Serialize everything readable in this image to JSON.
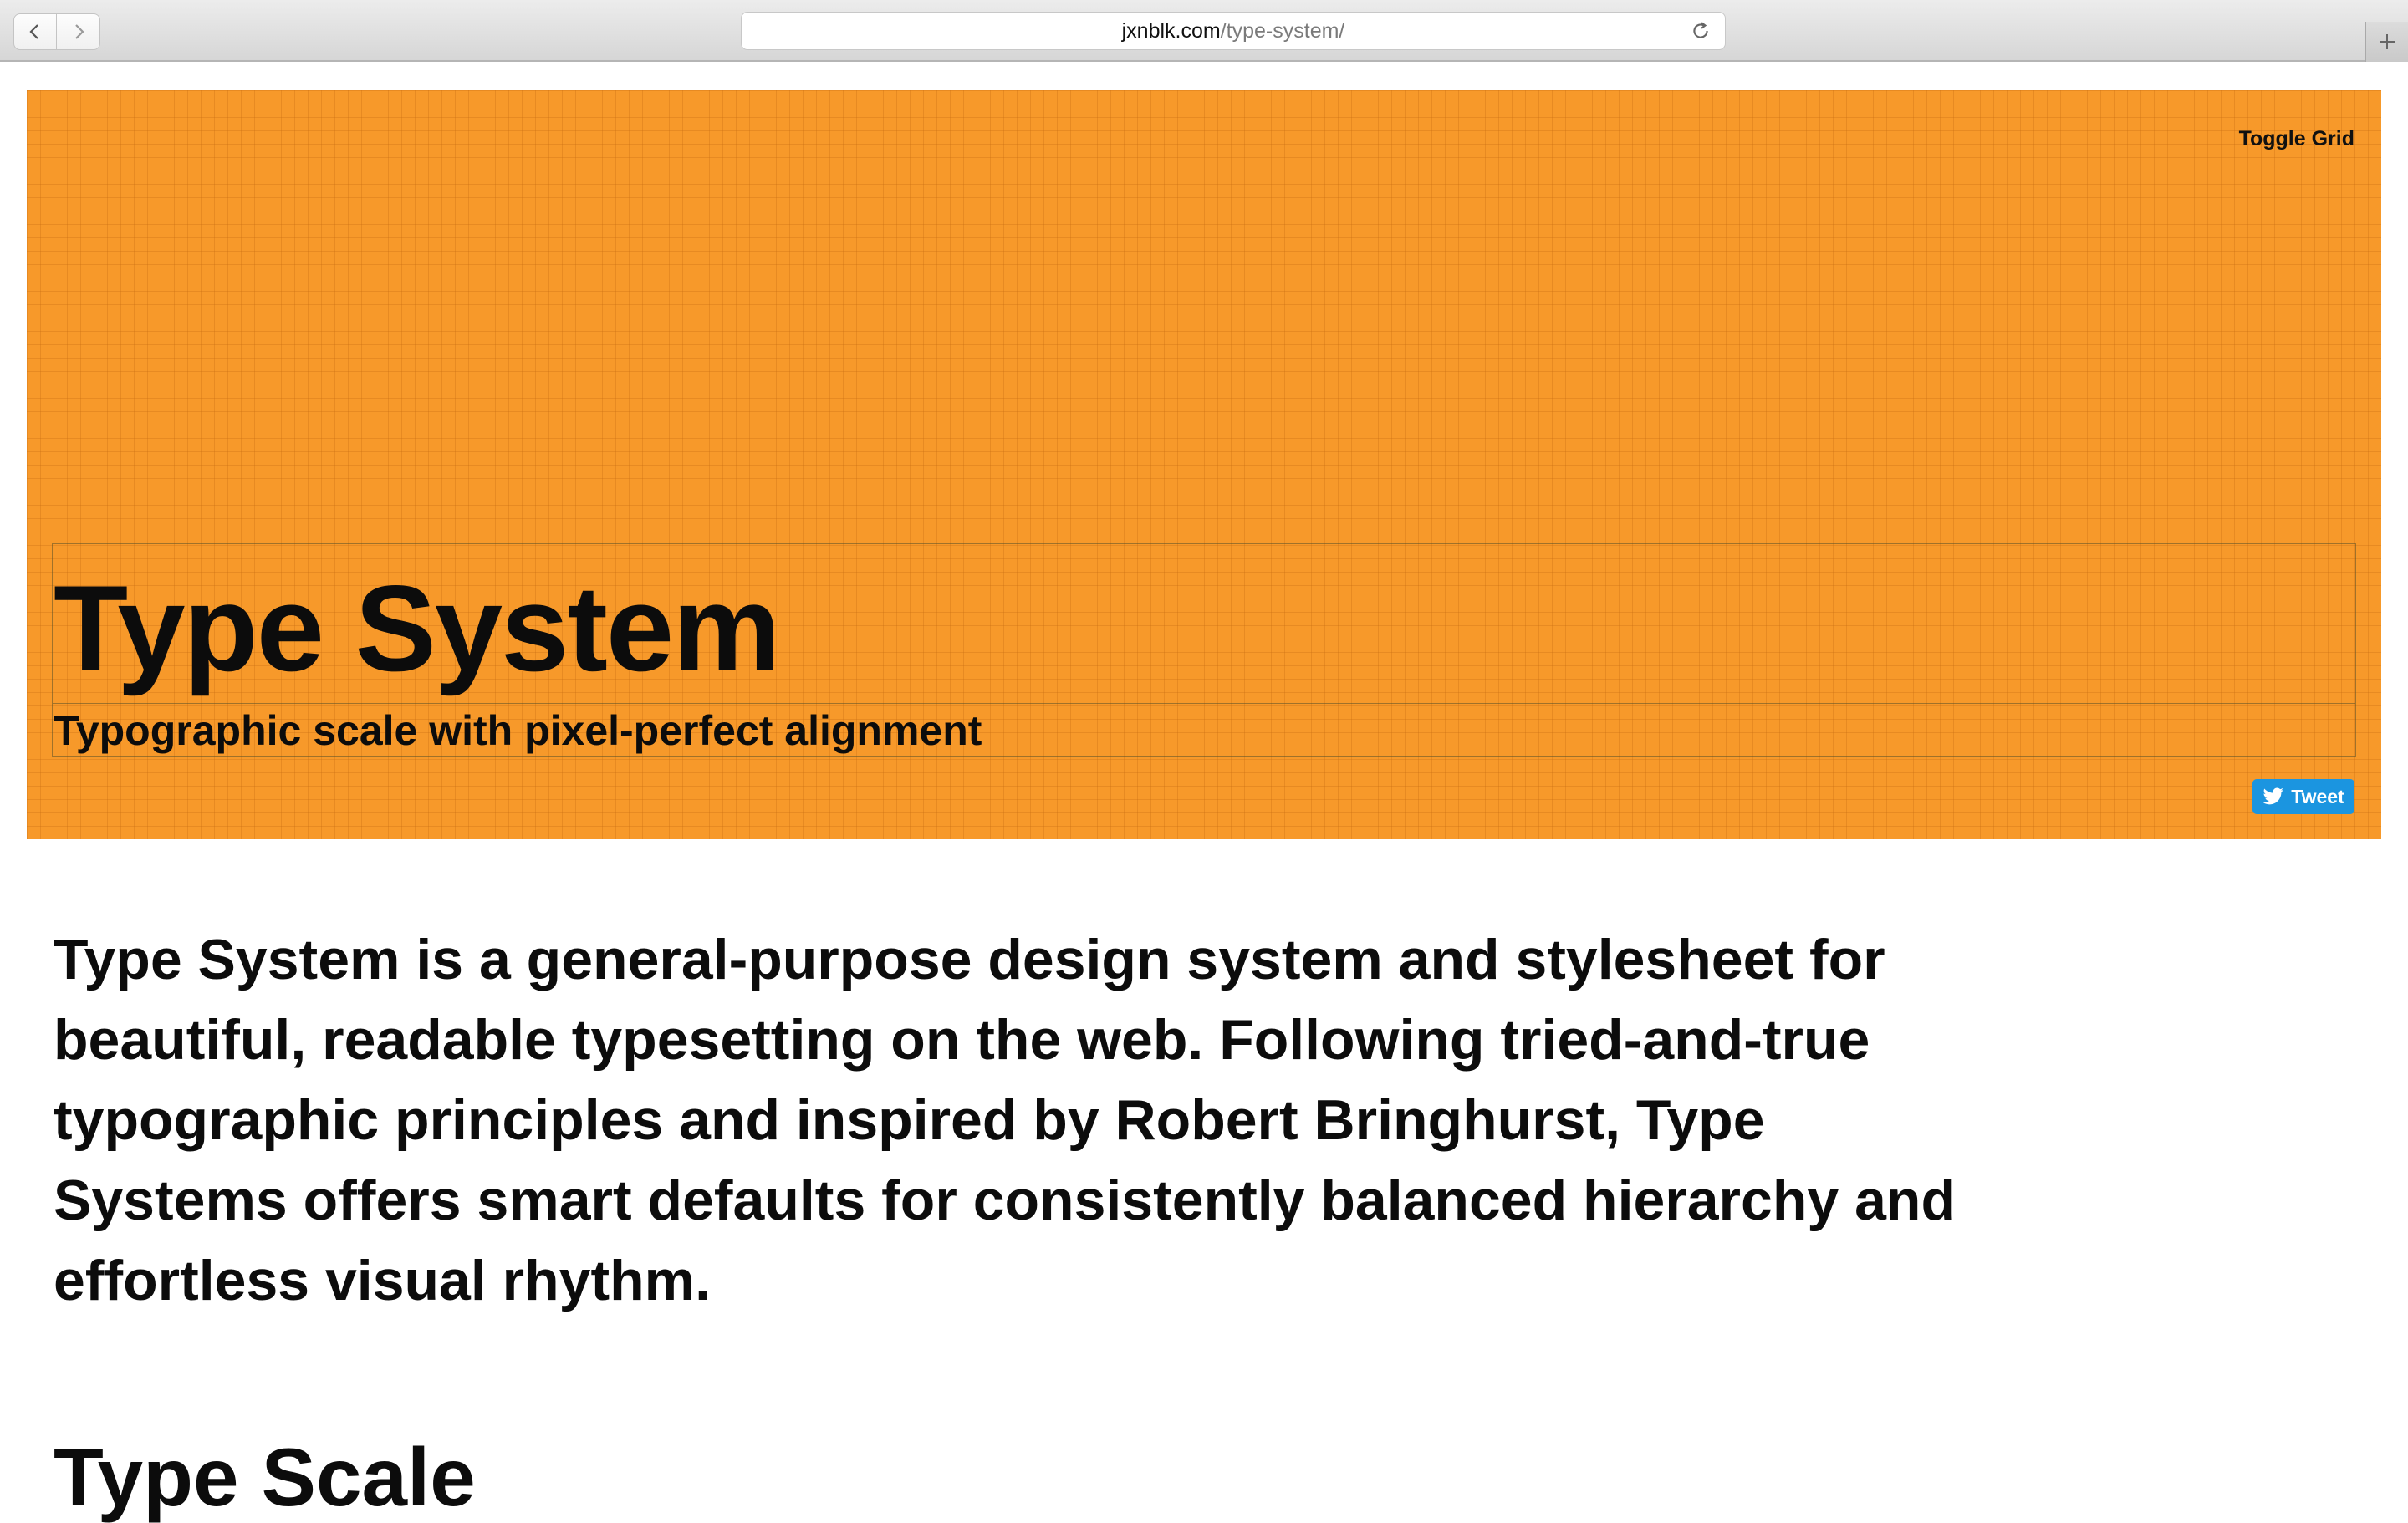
{
  "browser": {
    "url_host": "jxnblk.com",
    "url_path": "/type-system/",
    "icons": {
      "back": "chevron-left-icon",
      "forward": "chevron-right-icon",
      "reload": "reload-icon",
      "new_tab": "plus-icon"
    }
  },
  "hero": {
    "toggle_label": "Toggle Grid",
    "title": "Type System",
    "subtitle": "Typographic scale with pixel-perfect alignment",
    "tweet_label": "Tweet",
    "background_color": "#f7992a",
    "tweet_color": "#1b95e0"
  },
  "content": {
    "intro": "Type System is a general-purpose design system and stylesheet for beautiful, readable typesetting on the web. Following tried-and-true typographic principles and inspired by Robert Bringhurst, Type Systems offers smart defaults for consistently balanced hierarchy and effortless visual rhythm.",
    "section_heading": "Type Scale"
  }
}
